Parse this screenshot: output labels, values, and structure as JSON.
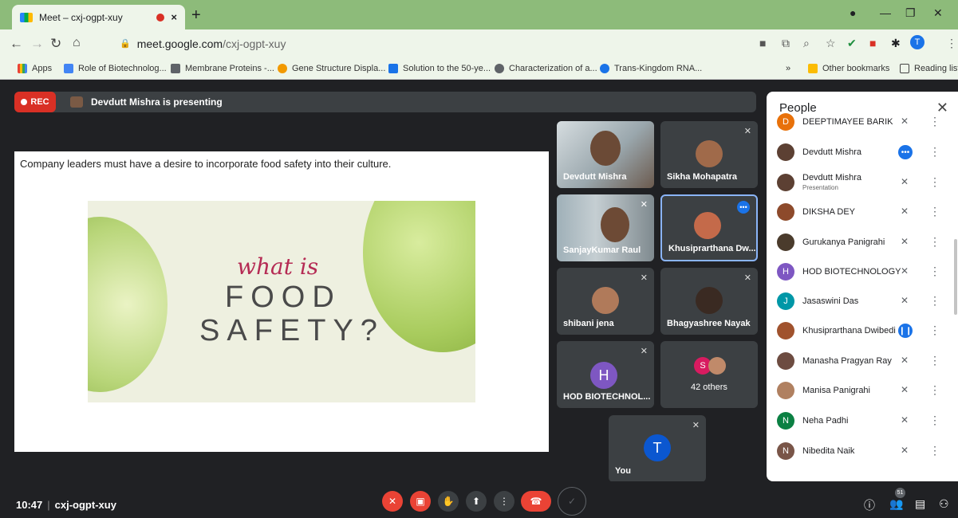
{
  "browser": {
    "tab_title": "Meet – cxj-ogpt-xuy",
    "tab_close": "×",
    "new_tab": "+",
    "url_host": "meet.google.com",
    "url_path": "/cxj-ogpt-xuy",
    "profile_initial": "T"
  },
  "bookmarks": {
    "items": [
      "Apps",
      "Role of Biotechnolog...",
      "Membrane Proteins -...",
      "Gene Structure Displa...",
      "Solution to the 50-ye...",
      "Characterization of a...",
      "Trans-Kingdom RNA..."
    ],
    "overflow": "»",
    "other": "Other bookmarks",
    "reading": "Reading list"
  },
  "meeting": {
    "rec_label": "REC",
    "presenting": "Devdutt Mishra is presenting",
    "slide_caption": "Company leaders must have a desire to incorporate food safety into their culture.",
    "slide_line1": "what is",
    "slide_line2": "FOOD",
    "slide_line3": "SAFETY?"
  },
  "tiles": [
    {
      "name": "Devdutt Mishra"
    },
    {
      "name": "Sikha Mohapatra"
    },
    {
      "name": "SanjayKumar Raul"
    },
    {
      "name": "Khusiprarthana Dw..."
    },
    {
      "name": "shibani jena"
    },
    {
      "name": "Bhagyashree Nayak"
    },
    {
      "name": "HOD BIOTECHNOL...",
      "initial": "H"
    },
    {
      "name": "42 others",
      "initial": "S"
    },
    {
      "name": "You",
      "initial": "T"
    }
  ],
  "people": {
    "title": "People",
    "rows": [
      {
        "name": "DEEPTIMAYEE BARIK",
        "initial": "D",
        "color": "#e8710a"
      },
      {
        "name": "Devdutt Mishra",
        "color": "#5c4033"
      },
      {
        "name": "Devdutt Mishra",
        "sub": "Presentation",
        "color": "#5c4033"
      },
      {
        "name": "DIKSHA DEY",
        "color": "#8d4a2b"
      },
      {
        "name": "Gurukanya Panigrahi",
        "color": "#4a3b2c"
      },
      {
        "name": "HOD BIOTECHNOLOGY",
        "initial": "H",
        "color": "#7e57c2"
      },
      {
        "name": "Jasaswini Das",
        "initial": "J",
        "color": "#0097a7"
      },
      {
        "name": "Khusiprarthana Dwibedi",
        "color": "#a0522d"
      },
      {
        "name": "Manasha Pragyan Ray",
        "color": "#6d4c41"
      },
      {
        "name": "Manisa Panigrahi",
        "color": "#b08060"
      },
      {
        "name": "Neha Padhi",
        "initial": "N",
        "color": "#0b8043"
      },
      {
        "name": "Nibedita Naik",
        "initial": "N",
        "color": "#795548"
      }
    ]
  },
  "bottom": {
    "time": "10:47",
    "code": "cxj-ogpt-xuy",
    "participants": "51"
  }
}
